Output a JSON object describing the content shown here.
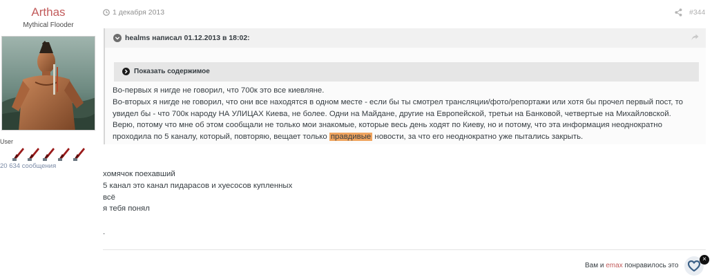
{
  "author": {
    "name": "Arthas",
    "title": "Mythical Flooder",
    "group": "User",
    "post_count": "20 634 сообщения",
    "rank_pips": 5
  },
  "post": {
    "date": "1 декабря 2013",
    "number": "#344"
  },
  "quote": {
    "citation": "healms написал 01.12.2013 в 18:02:",
    "spoiler_label": "Показать содержимое",
    "lines": [
      "Во-первых я нигде не говорил, что 700к это все киевляне.",
      "Во-вторых я нигде не говорил, что они все находятся в одном месте - если бы ты смотрел трансляции/фото/репортажи или хотя бы прочел первый пост, то",
      "увидел бы - что 700к народу НА УЛИЦАХ Киева, не более. Одни на Майдане, другие на Европейской, третьи на Банковой, четвертые на Михайловской.",
      "Верю, потому что мне об этом сообщали не только мои знакомые, которые весь день ходят по Киеву, но и потому, что эта информация неоднократно"
    ],
    "last_line_before": "проходила по 5 каналу, который, повторяю, вещает только ",
    "last_line_highlight": "правдивые",
    "last_line_after": " новости, за что его неоднократно уже пытались закрыть."
  },
  "body": {
    "lines": [
      "хомячок поехавший",
      "5 канал это канал пидарасов и хуесосов купленных",
      "всё",
      "я тебя понял"
    ],
    "trailing": "."
  },
  "likes": {
    "before": "Вам и ",
    "user": "emax",
    "after": " понравилось это",
    "badge": "×"
  },
  "colors": {
    "author_name": "#c25b5b",
    "highlight": "#f0a45e",
    "like_heart": "#3a5f86"
  }
}
